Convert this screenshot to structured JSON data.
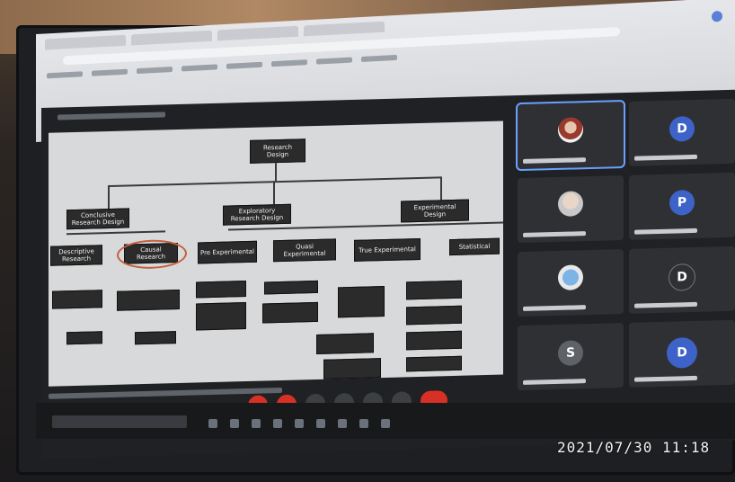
{
  "overlay": {
    "timestamp": "2021/07/30 11:18"
  },
  "colors": {
    "bezel": "#1e1f23",
    "meeting_bg": "#202124",
    "slide_bg": "#d7d9da",
    "highlight": "#c4603f",
    "end_call": "#d93025",
    "avatar_blue": "#3d63c8",
    "avatar_gray": "#5f6368"
  },
  "meeting": {
    "slide": {
      "nodes": [
        {
          "id": "root",
          "label": "Research Design"
        },
        {
          "id": "l1a",
          "label": "Conclusive Research Design"
        },
        {
          "id": "l1b",
          "label": "Exploratory Research Design"
        },
        {
          "id": "l1c",
          "label": "Experimental Design"
        },
        {
          "id": "l2a",
          "label": "Descriptive Research"
        },
        {
          "id": "l2b",
          "label": "Causal Research"
        },
        {
          "id": "l2c",
          "label": "Pre Experimental"
        },
        {
          "id": "l2d",
          "label": "Quasi Experimental"
        },
        {
          "id": "l2e",
          "label": "True Experimental"
        },
        {
          "id": "l2f",
          "label": "Statistical"
        }
      ]
    },
    "participants": [
      {
        "initial": "",
        "kind": "photo",
        "color": "#2f3034"
      },
      {
        "initial": "D",
        "kind": "letter",
        "color": "#3d63c8"
      },
      {
        "initial": "",
        "kind": "photo2",
        "color": "#2f3034"
      },
      {
        "initial": "P",
        "kind": "letter",
        "color": "#3d63c8"
      },
      {
        "initial": "",
        "kind": "photo3",
        "color": "#2f3034"
      },
      {
        "initial": "D",
        "kind": "letter",
        "color": "#2f3034"
      },
      {
        "initial": "S",
        "kind": "letter",
        "color": "#5f6368"
      },
      {
        "initial": "D",
        "kind": "letter",
        "color": "#3d63c8"
      }
    ]
  }
}
